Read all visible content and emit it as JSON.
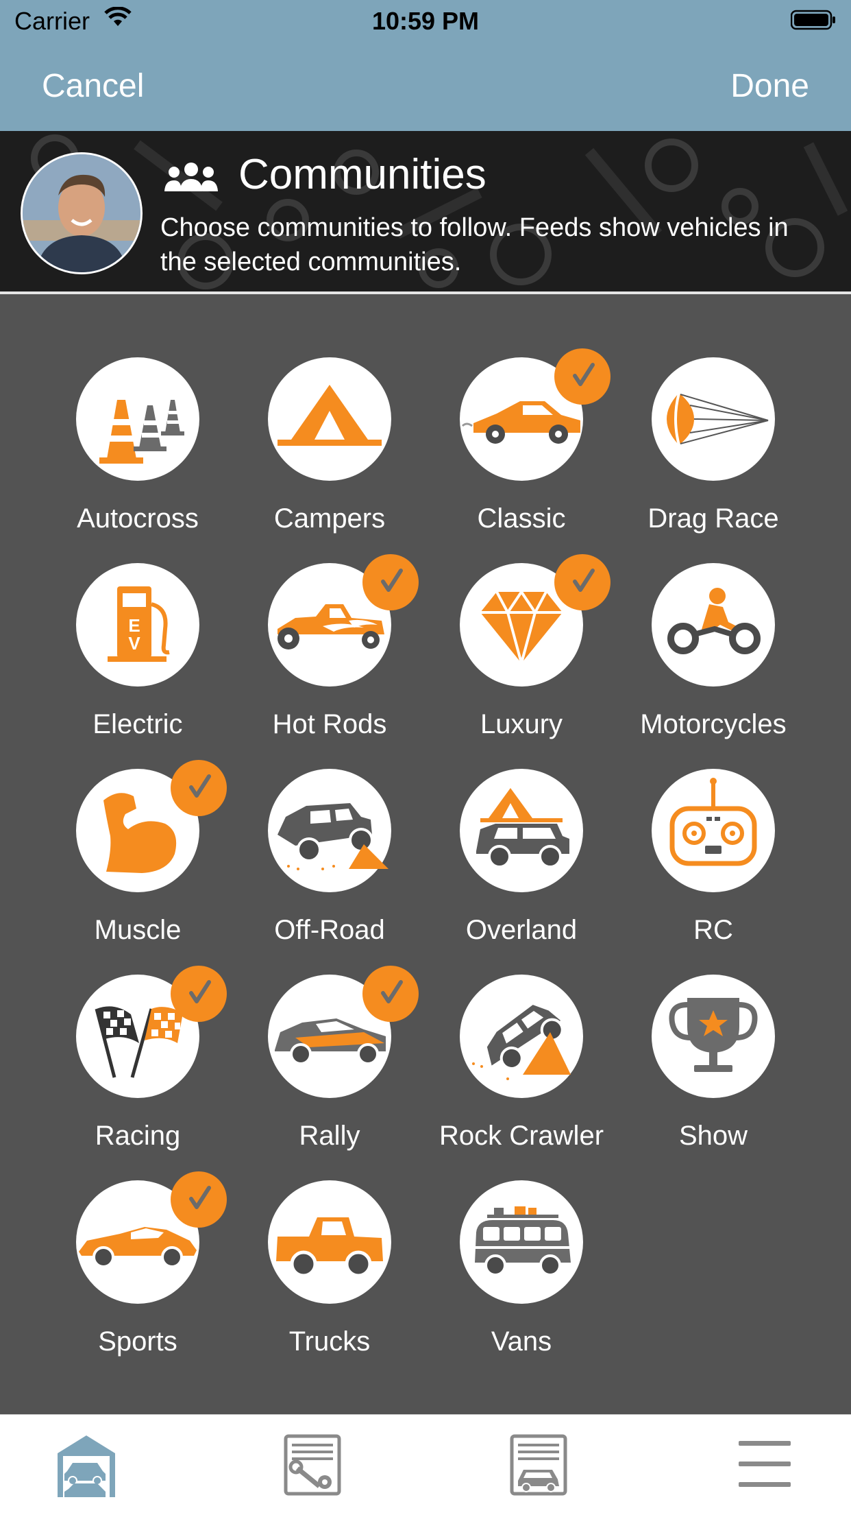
{
  "status_bar": {
    "carrier": "Carrier",
    "time": "10:59 PM"
  },
  "nav": {
    "cancel_label": "Cancel",
    "done_label": "Done"
  },
  "header": {
    "title": "Communities",
    "subtitle": "Choose communities to follow. Feeds show vehicles in the selected communities."
  },
  "colors": {
    "accent": "#f58c1f",
    "nav_bg": "#7ea5ba",
    "grid_bg": "#535353",
    "icon_gray": "#5a5a5a"
  },
  "communities": [
    {
      "label": "Autocross",
      "icon": "traffic-cones-icon",
      "selected": false
    },
    {
      "label": "Campers",
      "icon": "tent-icon",
      "selected": false
    },
    {
      "label": "Classic",
      "icon": "classic-car-icon",
      "selected": true
    },
    {
      "label": "Drag Race",
      "icon": "parachute-icon",
      "selected": false
    },
    {
      "label": "Electric",
      "icon": "ev-charger-icon",
      "selected": false
    },
    {
      "label": "Hot Rods",
      "icon": "hot-rod-flames-icon",
      "selected": true
    },
    {
      "label": "Luxury",
      "icon": "diamond-icon",
      "selected": true
    },
    {
      "label": "Motorcycles",
      "icon": "motorcycle-icon",
      "selected": false
    },
    {
      "label": "Muscle",
      "icon": "flexed-arm-icon",
      "selected": true
    },
    {
      "label": "Off-Road",
      "icon": "jeep-offroad-icon",
      "selected": false
    },
    {
      "label": "Overland",
      "icon": "roof-tent-jeep-icon",
      "selected": false
    },
    {
      "label": "RC",
      "icon": "rc-controller-icon",
      "selected": false
    },
    {
      "label": "Racing",
      "icon": "checkered-flags-icon",
      "selected": true
    },
    {
      "label": "Rally",
      "icon": "rally-car-icon",
      "selected": true
    },
    {
      "label": "Rock Crawler",
      "icon": "rock-crawler-icon",
      "selected": false
    },
    {
      "label": "Show",
      "icon": "trophy-icon",
      "selected": false
    },
    {
      "label": "Sports",
      "icon": "sports-car-icon",
      "selected": true
    },
    {
      "label": "Trucks",
      "icon": "pickup-truck-icon",
      "selected": false
    },
    {
      "label": "Vans",
      "icon": "camper-van-icon",
      "selected": false
    }
  ],
  "tabbar": [
    {
      "icon": "garage-icon",
      "active": true
    },
    {
      "icon": "service-records-icon",
      "active": false
    },
    {
      "icon": "vehicle-listing-icon",
      "active": false
    },
    {
      "icon": "menu-icon",
      "active": false
    }
  ]
}
